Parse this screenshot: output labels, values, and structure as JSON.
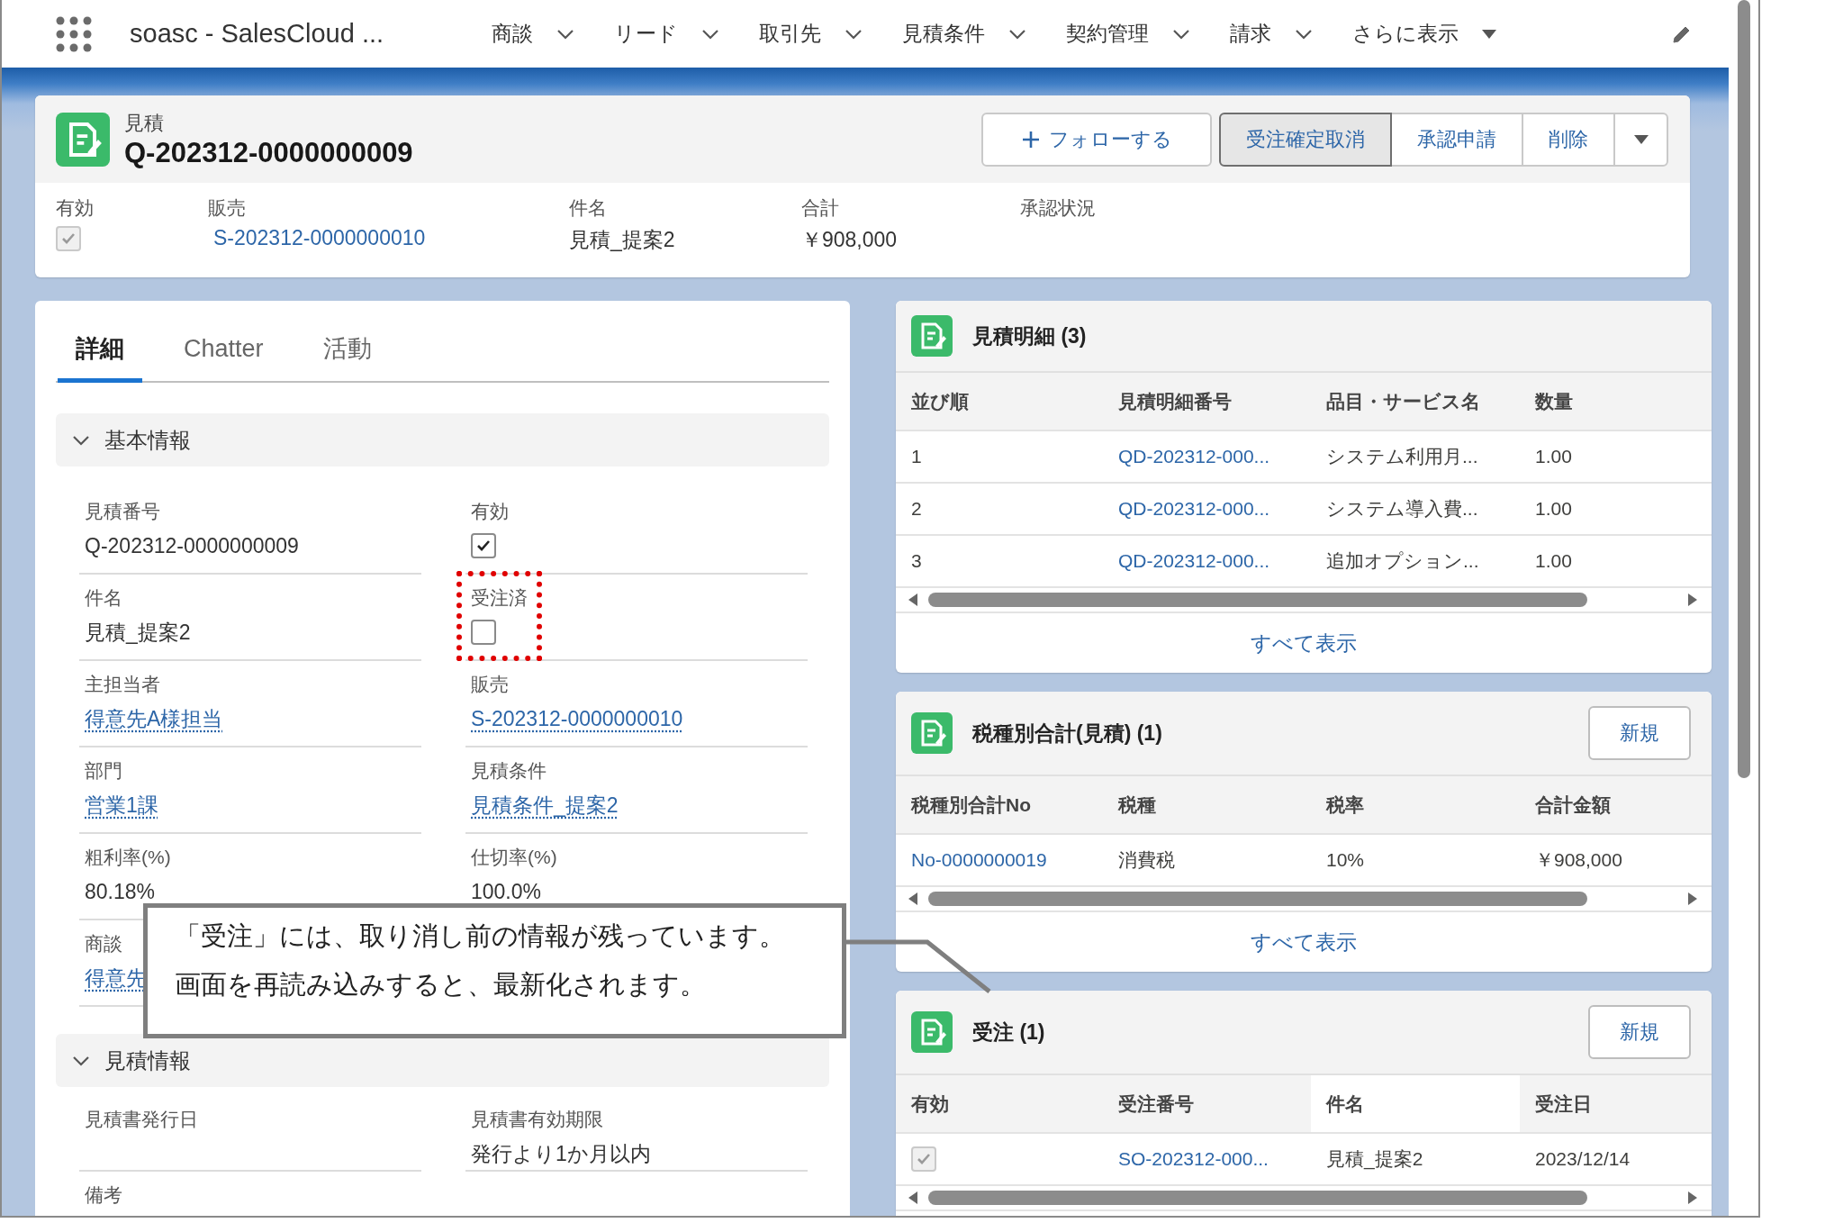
{
  "nav": {
    "app_name": "soasc - SalesCloud ...",
    "items": [
      {
        "label": "商談",
        "kind": "menu"
      },
      {
        "label": "リード",
        "kind": "menu"
      },
      {
        "label": "取引先",
        "kind": "menu"
      },
      {
        "label": "見積条件",
        "kind": "menu"
      },
      {
        "label": "契約管理",
        "kind": "menu"
      },
      {
        "label": "請求",
        "kind": "menu"
      },
      {
        "label": "さらに表示",
        "kind": "more"
      }
    ]
  },
  "record": {
    "object_type": "見積",
    "title": "Q-202312-0000000009",
    "actions": [
      {
        "label": "フォローする",
        "kind": "follow",
        "pressed": false
      },
      {
        "label": "受注確定取消",
        "kind": "group",
        "pressed": true
      },
      {
        "label": "承認申請",
        "kind": "group",
        "pressed": false
      },
      {
        "label": "削除",
        "kind": "group",
        "pressed": false
      },
      {
        "kind": "menu",
        "pressed": false
      }
    ],
    "highlights": [
      {
        "label": "有効",
        "kind": "checkbox",
        "checked": true,
        "disabled": true
      },
      {
        "label": "販売",
        "kind": "link",
        "value": "S-202312-0000000010"
      },
      {
        "label": "件名",
        "kind": "text",
        "value": "見積_提案2"
      },
      {
        "label": "合計",
        "kind": "text",
        "value": "￥908,000"
      },
      {
        "label": "承認状況",
        "kind": "text"
      }
    ]
  },
  "detail": {
    "tabs": [
      {
        "label": "詳細",
        "selected": true
      },
      {
        "label": "Chatter",
        "selected": false
      },
      {
        "label": "活動",
        "selected": false
      }
    ],
    "sections": [
      {
        "title": "基本情報",
        "expanded": true,
        "fields": [
          {
            "label": "見積番号",
            "kind": "text",
            "value": "Q-202312-0000000009"
          },
          {
            "label": "有効",
            "kind": "checkbox",
            "checked": true,
            "disabled": false
          },
          {
            "label": "件名",
            "kind": "text",
            "value": "見積_提案2"
          },
          {
            "label": "受注済",
            "kind": "checkbox",
            "checked": false,
            "disabled": false,
            "highlighted": true
          },
          {
            "label": "主担当者",
            "kind": "link",
            "value": "得意先A様担当"
          },
          {
            "label": "販売",
            "kind": "link",
            "value": "S-202312-0000000010"
          },
          {
            "label": "部門",
            "kind": "link",
            "value": "営業1課"
          },
          {
            "label": "見積条件",
            "kind": "link",
            "value": "見積条件_提案2"
          },
          {
            "label": "粗利率(%)",
            "kind": "text",
            "value": "80.18%"
          },
          {
            "label": "仕切率(%)",
            "kind": "text",
            "value": "100.0%"
          },
          {
            "label": "商談",
            "kind": "link",
            "value": "得意先"
          }
        ]
      },
      {
        "title": "見積情報",
        "expanded": true,
        "fields": [
          {
            "label": "見積書発行日",
            "kind": "text"
          },
          {
            "label": "見積書有効期限",
            "kind": "text",
            "value": "発行より1か月以内"
          },
          {
            "label": "備考",
            "kind": "text"
          }
        ]
      }
    ]
  },
  "related": [
    {
      "title": "見積明細 (3)",
      "columns": [
        {
          "label": "並び順",
          "hovered": false
        },
        {
          "label": "見積明細番号",
          "hovered": false
        },
        {
          "label": "品目・サービス名",
          "hovered": false
        },
        {
          "label": "数量",
          "hovered": false
        }
      ],
      "rows": [
        [
          {
            "kind": "text",
            "text": "1"
          },
          {
            "kind": "link",
            "text": "QD-202312-000..."
          },
          {
            "kind": "text",
            "text": "システム利用月..."
          },
          {
            "kind": "text",
            "text": "1.00"
          }
        ],
        [
          {
            "kind": "text",
            "text": "2"
          },
          {
            "kind": "link",
            "text": "QD-202312-000..."
          },
          {
            "kind": "text",
            "text": "システム導入費..."
          },
          {
            "kind": "text",
            "text": "1.00"
          }
        ],
        [
          {
            "kind": "text",
            "text": "3"
          },
          {
            "kind": "link",
            "text": "QD-202312-000..."
          },
          {
            "kind": "text",
            "text": "追加オプション..."
          },
          {
            "kind": "text",
            "text": "1.00"
          }
        ]
      ],
      "footer": "すべて表示"
    },
    {
      "title": "税種別合計(見積) (1)",
      "button": "新規",
      "columns": [
        {
          "label": "税種別合計No",
          "hovered": false
        },
        {
          "label": "税種",
          "hovered": false
        },
        {
          "label": "税率",
          "hovered": false
        },
        {
          "label": "合計金額",
          "hovered": false
        }
      ],
      "rows": [
        [
          {
            "kind": "link",
            "text": "No-0000000019"
          },
          {
            "kind": "text",
            "text": "消費税"
          },
          {
            "kind": "text",
            "text": "10%"
          },
          {
            "kind": "text",
            "text": "￥908,000"
          }
        ]
      ],
      "footer": "すべて表示"
    },
    {
      "title": "受注 (1)",
      "button": "新規",
      "columns": [
        {
          "label": "有効",
          "hovered": false
        },
        {
          "label": "受注番号",
          "hovered": false
        },
        {
          "label": "件名",
          "hovered": true
        },
        {
          "label": "受注日",
          "hovered": false
        }
      ],
      "rows": [
        [
          {
            "kind": "checkbox",
            "checked": true,
            "disabled": true
          },
          {
            "kind": "link",
            "text": "SO-202312-000..."
          },
          {
            "kind": "text",
            "text": "見積_提案2"
          },
          {
            "kind": "text",
            "text": "2023/12/14"
          }
        ]
      ]
    }
  ],
  "callout": {
    "lines": [
      "「受注」には、取り消し前の情報が残っています。",
      "画面を再読み込みすると、最新化されます。"
    ]
  }
}
